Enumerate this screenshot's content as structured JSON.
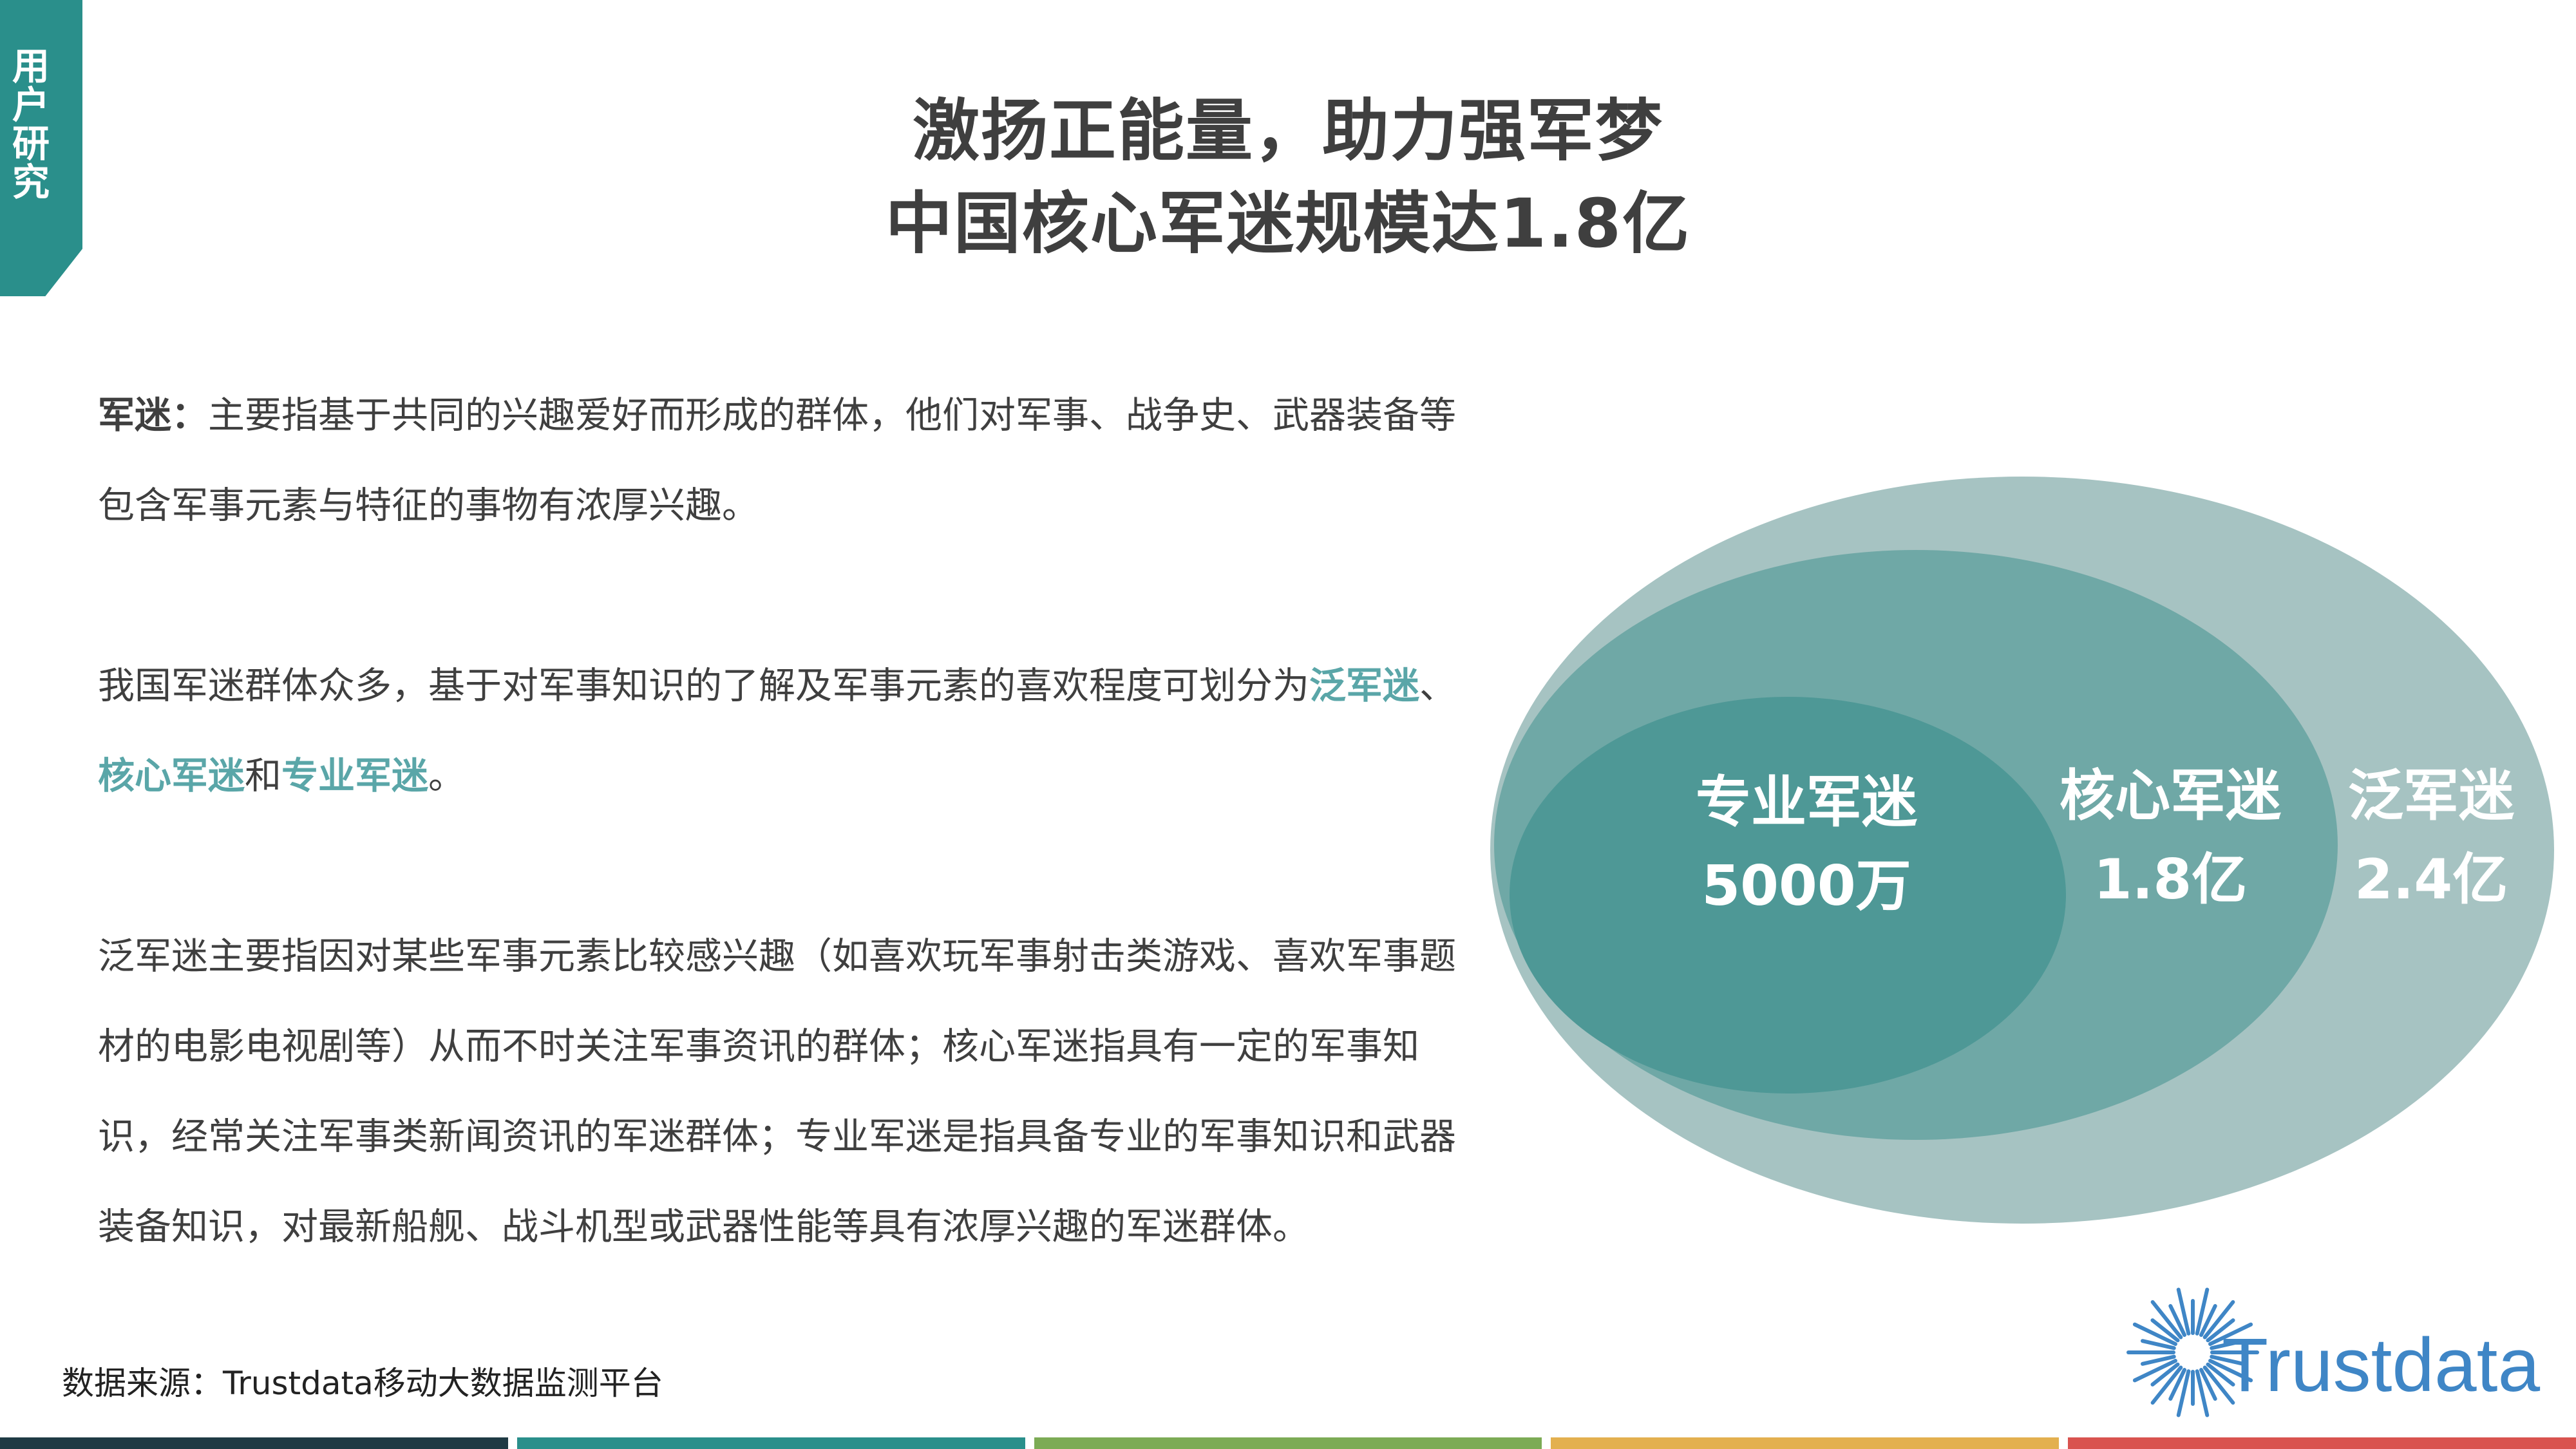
{
  "section_tab": "用户研究",
  "title": {
    "line1": "激扬正能量，助力强军梦",
    "line2": "中国核心军迷规模达1.8亿"
  },
  "definition": {
    "term": "军迷：",
    "text": "主要指基于共同的兴趣爱好而形成的群体，他们对军事、战争史、武器装备等包含军事元素与特征的事物有浓厚兴趣。"
  },
  "classification": {
    "prefix": "我国军迷群体众多，基于对军事知识的了解及军事元素的喜欢程度可划分为",
    "term1": "泛军迷",
    "sep1": "、",
    "term2": "核心军迷",
    "sep2": "和",
    "term3": "专业军迷",
    "end": "。"
  },
  "explanation": "泛军迷主要指因对某些军事元素比较感兴趣（如喜欢玩军事射击类游戏、喜欢军事题材的电影电视剧等）从而不时关注军事资讯的群体；核心军迷指具有一定的军事知识，经常关注军事类新闻资讯的军迷群体；专业军迷是指具备专业的军事知识和武器装备知识，对最新船舰、战斗机型或武器性能等具有浓厚兴趣的军迷群体。",
  "venn": {
    "outer": {
      "label": "泛军迷",
      "value": "2.4亿",
      "color": "#a6c3c2"
    },
    "middle": {
      "label": "核心军迷",
      "value": "1.8亿",
      "color": "#6fa8a6"
    },
    "inner": {
      "label": "专业军迷",
      "value": "5000万",
      "color": "#4e9896"
    }
  },
  "source": "数据来源：Trustdata移动大数据监测平台",
  "logo_text": "Trustdata",
  "colors": {
    "accent": "#2a8f8b",
    "highlight": "#5aa6a8",
    "bars": [
      "#1f3a44",
      "#2a8f8b",
      "#7cab55",
      "#e3b04f",
      "#d9534f"
    ]
  }
}
